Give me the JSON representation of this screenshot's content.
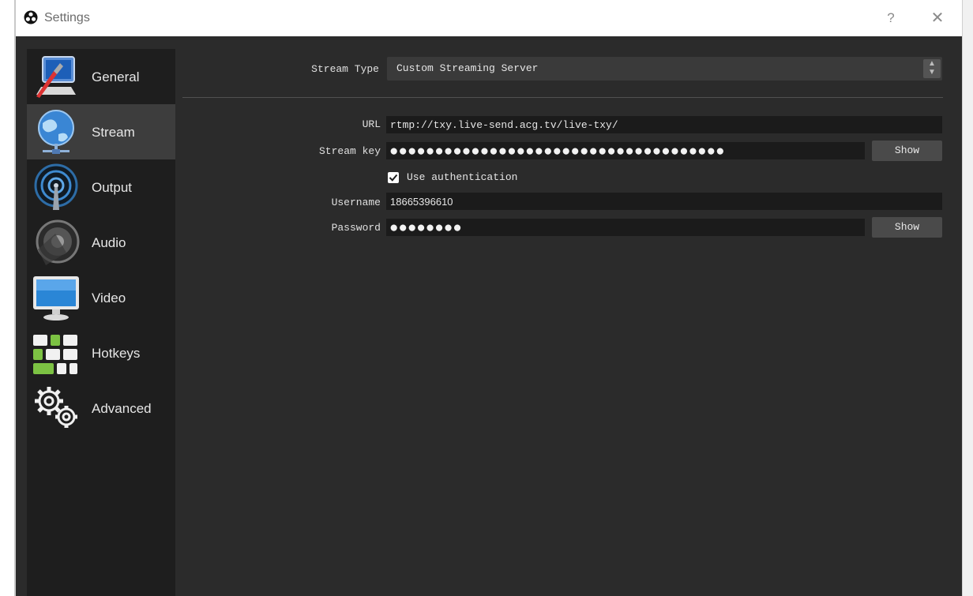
{
  "window": {
    "title": "Settings",
    "help_glyph": "?",
    "close_glyph": "✕"
  },
  "sidebar": {
    "items": [
      {
        "label": "General",
        "icon": "general-icon",
        "active": false
      },
      {
        "label": "Stream",
        "icon": "stream-globe-icon",
        "active": true
      },
      {
        "label": "Output",
        "icon": "output-icon",
        "active": false
      },
      {
        "label": "Audio",
        "icon": "speaker-icon",
        "active": false
      },
      {
        "label": "Video",
        "icon": "monitor-icon",
        "active": false
      },
      {
        "label": "Hotkeys",
        "icon": "keyboard-icon",
        "active": false
      },
      {
        "label": "Advanced",
        "icon": "gears-icon",
        "active": false
      }
    ]
  },
  "stream": {
    "type_label": "Stream Type",
    "type_value": "Custom Streaming Server",
    "url_label": "URL",
    "url_value": "rtmp://txy.live-send.acg.tv/live-txy/",
    "key_label": "Stream key",
    "key_mask": "●●●●●●●●●●●●●●●●●●●●●●●●●●●●●●●●●●●●●",
    "key_show": "Show",
    "auth_label": "Use authentication",
    "auth_checked": true,
    "username_label": "Username",
    "username_value": "18665396610",
    "password_label": "Password",
    "password_mask": "●●●●●●●●",
    "password_show": "Show"
  },
  "colors": {
    "background": "#2b2b2b",
    "sidebar": "#1e1e1e",
    "active_item": "#3d3d3d",
    "field": "#1b1b1b"
  }
}
